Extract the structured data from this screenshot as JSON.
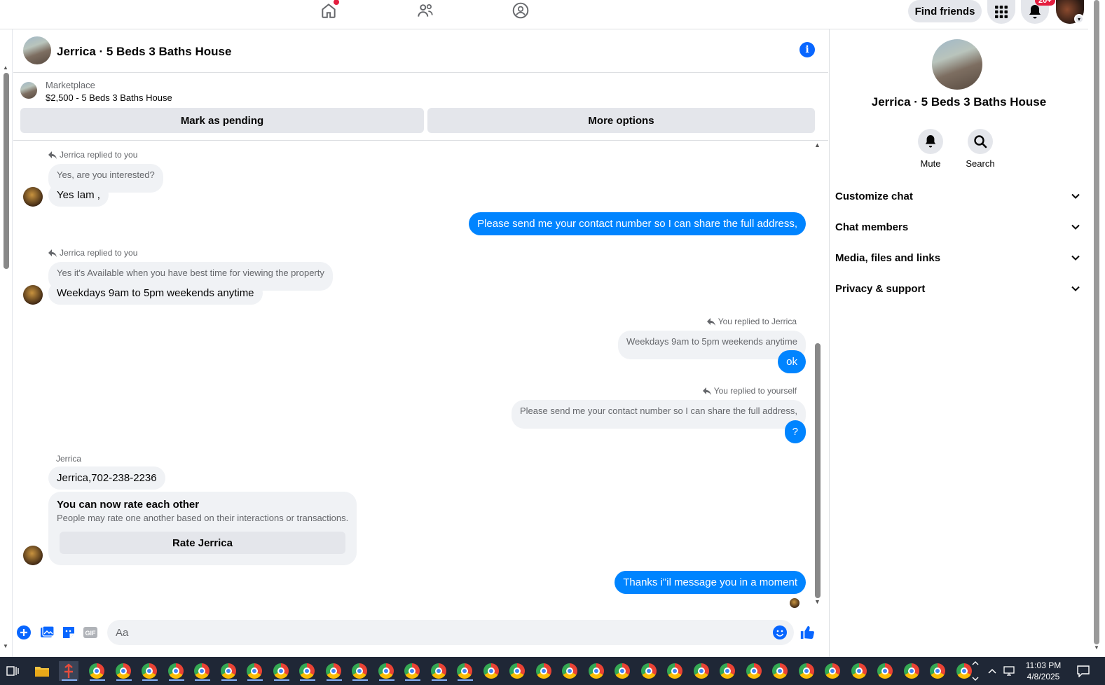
{
  "topnav": {
    "find_friends": "Find friends",
    "notification_count": "20+",
    "icons": [
      "home-icon",
      "friends-icon",
      "groups-icon",
      "apps-grid-icon",
      "bell-icon"
    ]
  },
  "chat": {
    "title": "Jerrica · 5 Beds 3 Baths House"
  },
  "marketplace": {
    "label": "Marketplace",
    "price_title": "$2,500 - 5 Beds 3 Baths House",
    "mark_pending": "Mark as pending",
    "more_options": "More options"
  },
  "messages": {
    "reply1_header": "Jerrica replied to you",
    "reply1_quote": "Yes, are you interested?",
    "reply1_text": "Yes Iam ,",
    "out1": "Please send me your contact number so I can share the full address,",
    "reply2_header": "Jerrica replied to you",
    "reply2_quote": "Yes it's Available when you have best time for viewing the property",
    "reply2_text": "Weekdays 9am to 5pm weekends anytime",
    "reply3_header": "You replied to Jerrica",
    "reply3_quote": "Weekdays 9am to 5pm weekends anytime",
    "reply3_text": "ok",
    "reply4_header": "You replied to yourself",
    "reply4_quote": "Please send me your contact number so I can share the full address,",
    "reply4_text": "?",
    "sender_name": "Jerrica",
    "contact_msg": "Jerrica,702-238-2236",
    "rate_title": "You can now rate each other",
    "rate_subtitle": "People may rate one another based on their interactions or transactions.",
    "rate_button": "Rate Jerrica",
    "out2": "Thanks i\"il message you in a moment"
  },
  "composer": {
    "placeholder": "Aa",
    "gif_label": "GIF"
  },
  "rightpanel": {
    "name": "Jerrica · 5 Beds 3 Baths House",
    "mute": "Mute",
    "search": "Search",
    "sections": [
      "Customize chat",
      "Chat members",
      "Media, files and links",
      "Privacy & support"
    ]
  },
  "taskbar": {
    "time": "11:03 PM",
    "date": "4/8/2025"
  },
  "colors": {
    "accent": "#0084ff",
    "link_blue": "#0866ff",
    "bubble_gray": "#f0f2f5",
    "taskbar": "#1f2736"
  }
}
